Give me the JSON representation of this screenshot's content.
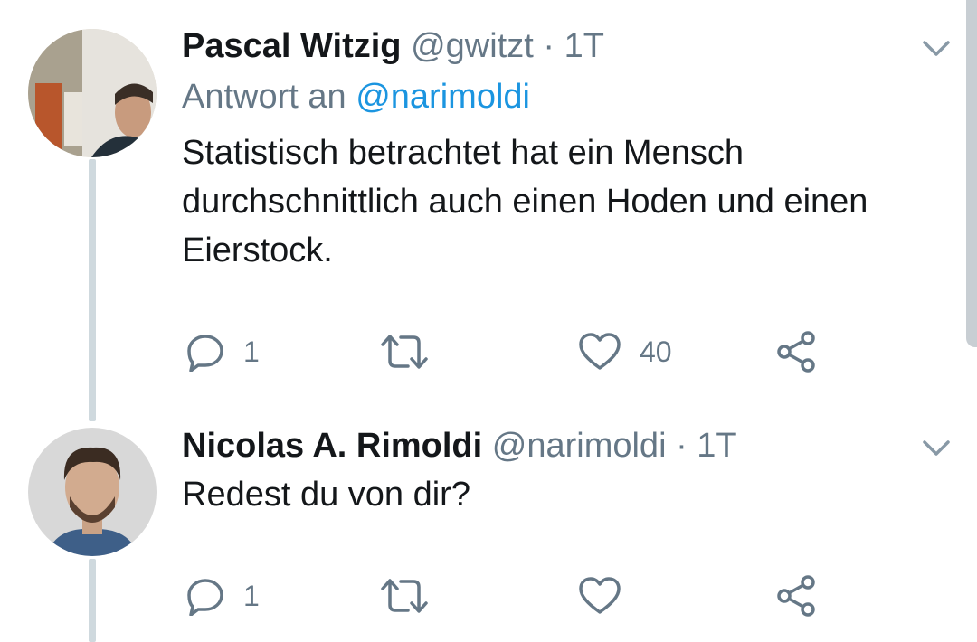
{
  "tweets": [
    {
      "name": "Pascal Witzig",
      "handle": "@gwitzt",
      "separator": "·",
      "time": "1T",
      "reply_prefix": "Antwort an",
      "reply_handle": "@narimoldi",
      "text": "Statistisch betrachtet hat ein Mensch durchschnittlich auch einen Hoden und einen Eierstock.",
      "reply_count": "1",
      "like_count": "40",
      "avatar_icon": "profile-photo-pascal"
    },
    {
      "name": "Nicolas A. Rimoldi",
      "handle": "@narimoldi",
      "separator": "·",
      "time": "1T",
      "text": "Redest du von dir?",
      "reply_count": "1",
      "like_count": "",
      "avatar_icon": "profile-photo-nicolas"
    }
  ],
  "colors": {
    "text": "#14171a",
    "secondary": "#657786",
    "link": "#1b95e0",
    "thread_line": "#cfd9de"
  }
}
